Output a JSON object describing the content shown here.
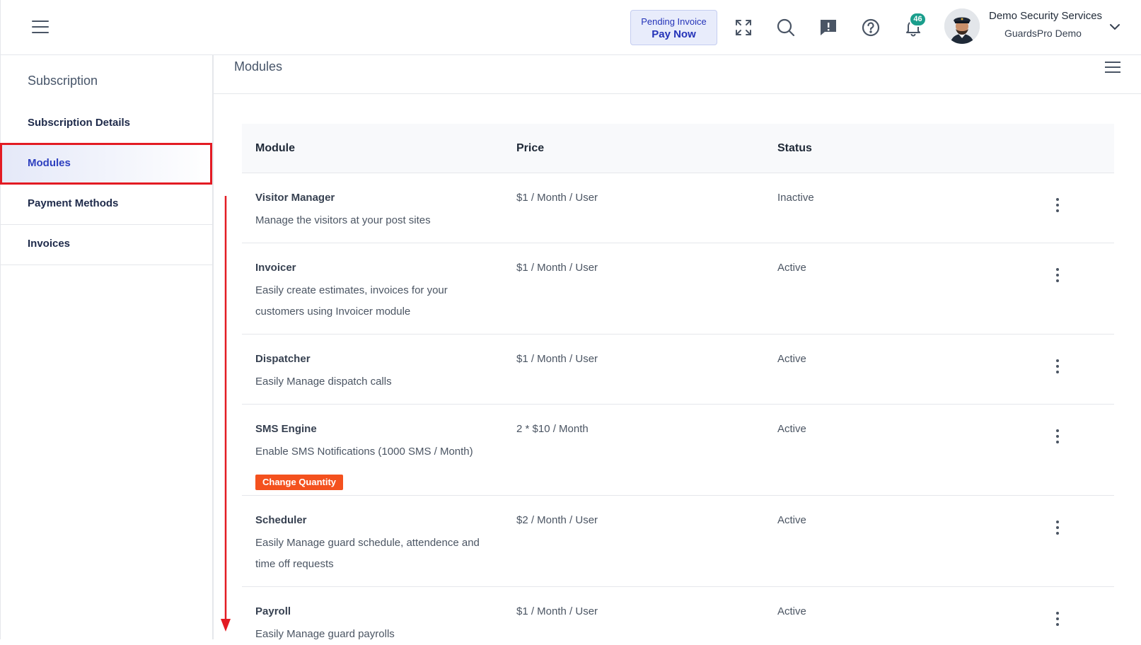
{
  "header": {
    "pending_invoice_label": "Pending Invoice",
    "pay_now_label": "Pay Now",
    "notification_count": "46",
    "user_name": "Demo Security Services",
    "company_name": "GuardsPro Demo"
  },
  "sidebar": {
    "title": "Subscription",
    "items": [
      {
        "label": "Subscription Details"
      },
      {
        "label": "Modules"
      },
      {
        "label": "Payment Methods"
      },
      {
        "label": "Invoices"
      }
    ],
    "active_item": "Modules"
  },
  "main": {
    "title": "Modules",
    "columns": [
      "Module",
      "Price",
      "Status"
    ],
    "rows": [
      {
        "name": "Visitor Manager",
        "description": "Manage the visitors at your post sites",
        "price": "$1 / Month / User",
        "status": "Inactive"
      },
      {
        "name": "Invoicer",
        "description": "Easily create estimates, invoices for your customers using Invoicer module",
        "price": "$1 / Month / User",
        "status": "Active"
      },
      {
        "name": "Dispatcher",
        "description": "Easily Manage dispatch calls",
        "price": "$1 / Month / User",
        "status": "Active"
      },
      {
        "name": "SMS Engine",
        "description": "Enable SMS Notifications (1000 SMS / Month)",
        "price": "2 * $10 / Month",
        "status": "Active",
        "action_label": "Change Quantity"
      },
      {
        "name": "Scheduler",
        "description": "Easily Manage guard schedule, attendence and time off requests",
        "price": "$2 / Month / User",
        "status": "Active"
      },
      {
        "name": "Payroll",
        "description": "Easily Manage guard payrolls",
        "price": "$1 / Month / User",
        "status": "Active"
      }
    ]
  },
  "colors": {
    "accent": "#2433b8",
    "highlight": "#e31b23",
    "change_qty": "#f4511e",
    "badge": "#1a9e8c"
  }
}
